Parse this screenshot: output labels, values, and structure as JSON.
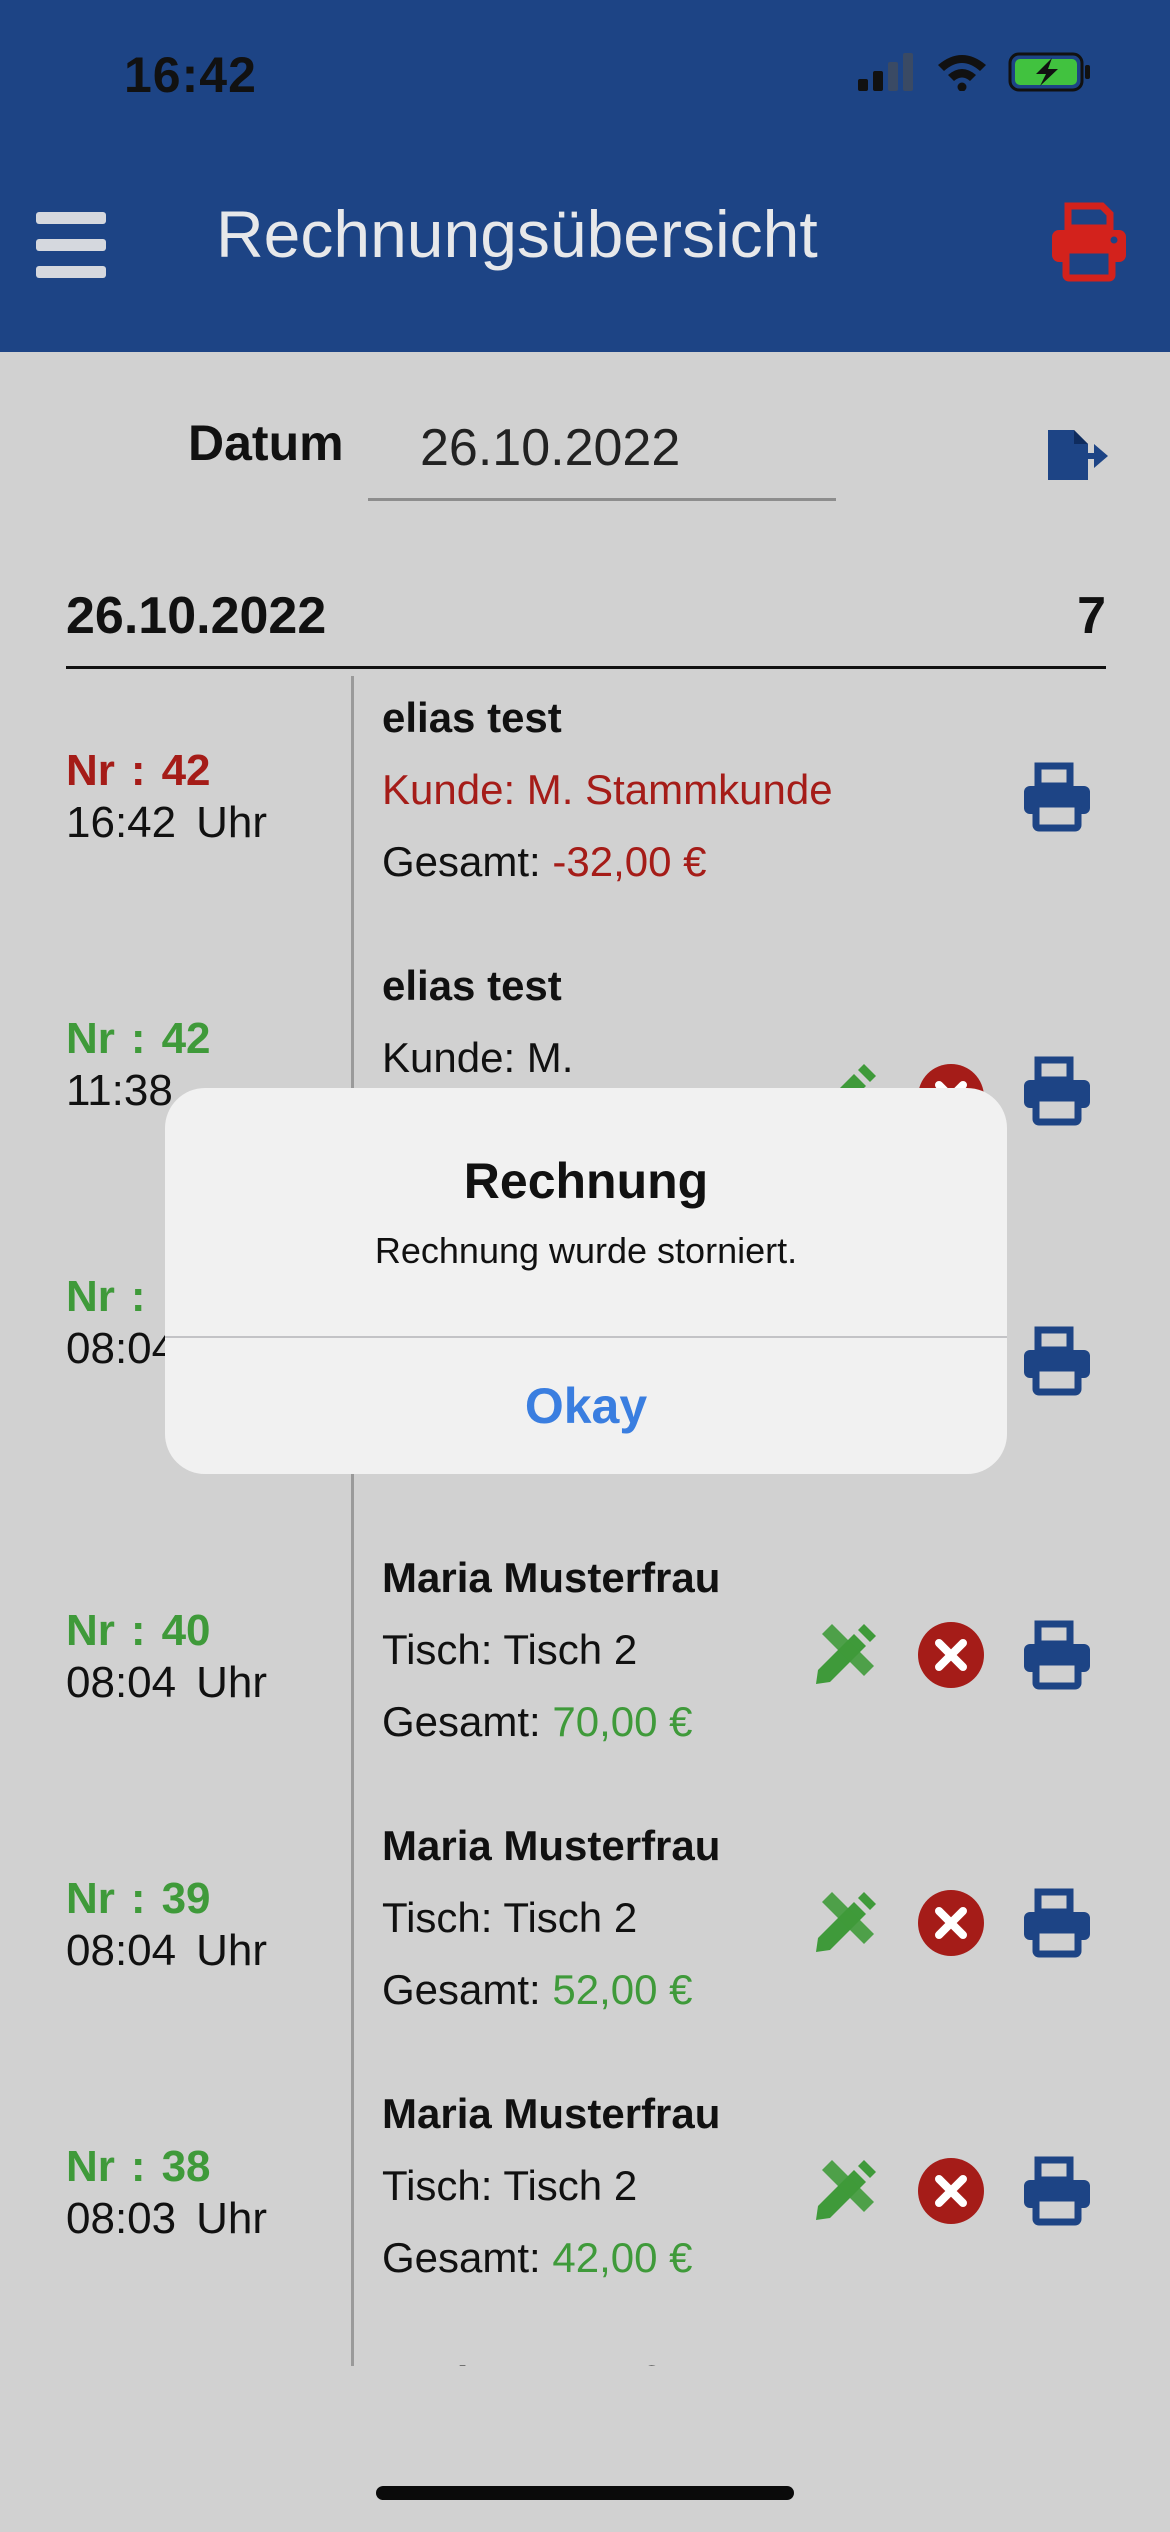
{
  "status": {
    "time": "16:42"
  },
  "appbar": {
    "title": "Rechnungsübersicht"
  },
  "filter": {
    "label": "Datum",
    "value": "26.10.2022"
  },
  "section": {
    "date": "26.10.2022",
    "count": "7"
  },
  "list_labels": {
    "nr": "Nr",
    "colon": ":",
    "uhr": "Uhr",
    "kunde_prefix": "Kunde:",
    "tisch_prefix": "Tisch:",
    "gesamt_prefix": "Gesamt:"
  },
  "rows": [
    {
      "nr": "42",
      "time": "16:42",
      "name": "elias test",
      "line2": "Kunde: M. Stammkunde",
      "line3_label": "Gesamt:",
      "total": "-32,00 €"
    },
    {
      "nr": "42",
      "time": "11:38",
      "name": "elias test",
      "line2": "Kunde: M.",
      "line3_label": "",
      "total": ""
    },
    {
      "nr": "",
      "time": "08:04",
      "name": "",
      "line2": "",
      "line3_label": "",
      "total": ""
    },
    {
      "nr": "40",
      "time": "08:04",
      "name": "Maria Musterfrau",
      "line2": "Tisch: Tisch 2",
      "line3_label": "Gesamt:",
      "total": "70,00 €"
    },
    {
      "nr": "39",
      "time": "08:04",
      "name": "Maria Musterfrau",
      "line2": "Tisch: Tisch 2",
      "line3_label": "Gesamt:",
      "total": "52,00 €"
    },
    {
      "nr": "38",
      "time": "08:03",
      "name": "Maria Musterfrau",
      "line2": "Tisch: Tisch 2",
      "line3_label": "Gesamt:",
      "total": "42,00 €"
    },
    {
      "nr": "",
      "time": "",
      "name": "Maria Musterfrau",
      "line2": "",
      "line3_label": "",
      "total": ""
    }
  ],
  "dialog": {
    "title": "Rechnung",
    "message": "Rechnung wurde storniert.",
    "button": "Okay"
  },
  "colors": {
    "appbar": "#1d4485",
    "cancelled": "#a51c18",
    "active": "#3f9a3a",
    "print": "#1d4485",
    "dialog_button": "#3a7ee0"
  },
  "icons": [
    "menu-icon",
    "printer-icon",
    "file-export-icon",
    "edit-icon",
    "cancel-icon"
  ]
}
